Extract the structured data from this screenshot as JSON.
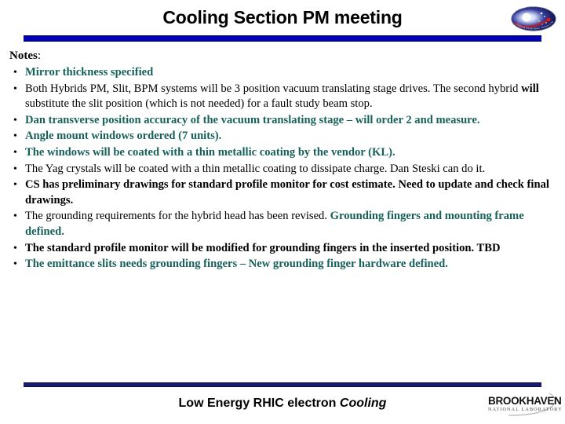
{
  "slide": {
    "title": "Cooling Section PM meeting",
    "notes_heading_label": "Notes",
    "notes_heading_colon": ":",
    "footer_main": "Low Energy RHIC electron ",
    "footer_italic": "Cooling"
  },
  "logos": {
    "top_right": {
      "name": "office-of-nuclear-physics-emblem",
      "arc_top_text": "Office of Nuclear Physics",
      "arc_bottom_text": "Exploring Nuclear Matter - Nucleus to Stars"
    },
    "bottom_right": {
      "name": "brookhaven-national-laboratory-logo",
      "line1": "BROOKHAVEN",
      "line2": "NATIONAL LABORATORY"
    }
  },
  "colors": {
    "title_rule": "#0000B5",
    "footer_rule": "#1A1A6E",
    "highlight_teal": "#17615A",
    "body_black": "#000000",
    "background": "#FFFFFF"
  },
  "bullets": [
    {
      "bullet_color": "teal",
      "segments": [
        {
          "style": "teal",
          "text": "Mirror thickness specified"
        }
      ]
    },
    {
      "bullet_color": "black",
      "segments": [
        {
          "style": "black-plain",
          "text": "Both Hybrids PM, Slit, BPM systems will be 3 position vacuum translating stage drives.  The second hybrid "
        },
        {
          "style": "inline-bold",
          "text": "will"
        },
        {
          "style": "black-plain",
          "text": " substitute the slit position (which is not needed) for a fault study beam stop."
        }
      ]
    },
    {
      "bullet_color": "teal",
      "segments": [
        {
          "style": "teal",
          "text": "Dan transverse position accuracy of the vacuum translating stage – will order 2 and measure."
        }
      ]
    },
    {
      "bullet_color": "teal",
      "segments": [
        {
          "style": "teal",
          "text": "Angle mount windows ordered (7 units)."
        }
      ]
    },
    {
      "bullet_color": "teal",
      "segments": [
        {
          "style": "teal",
          "text": "The windows will be coated with a thin metallic coating by the vendor (KL)."
        }
      ]
    },
    {
      "bullet_color": "black",
      "segments": [
        {
          "style": "black-plain",
          "text": "The  Yag crystals will be coated with a thin metallic coating to dissipate charge.  Dan Steski can do it."
        }
      ]
    },
    {
      "bullet_color": "black",
      "segments": [
        {
          "style": "black-bold",
          "text": "CS has preliminary drawings for standard profile monitor for cost estimate.  Need to update and check final drawings."
        }
      ]
    },
    {
      "bullet_color": "black",
      "segments": [
        {
          "style": "black-plain",
          "text": "The grounding requirements for the hybrid head has been revised.  "
        },
        {
          "style": "teal",
          "text": "Grounding fingers and mounting frame defined."
        }
      ]
    },
    {
      "bullet_color": "black",
      "segments": [
        {
          "style": "black-bold",
          "text": "The standard profile monitor will be modified for grounding fingers in the inserted position.  TBD"
        }
      ]
    },
    {
      "bullet_color": "teal",
      "segments": [
        {
          "style": "teal",
          "text": "The emittance slits needs grounding fingers – New grounding finger hardware defined."
        }
      ]
    }
  ]
}
